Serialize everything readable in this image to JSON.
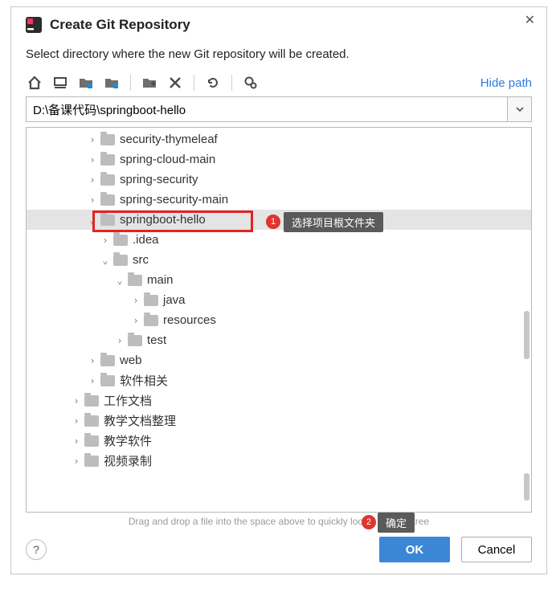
{
  "dialog": {
    "title": "Create Git Repository",
    "subtitle": "Select directory where the new Git repository will be created.",
    "hide_path": "Hide path",
    "hint": "Drag and drop a file into the space above to quickly locate it in the tree",
    "ok": "OK",
    "cancel": "Cancel"
  },
  "path": {
    "value": "D:\\备课代码\\springboot-hello"
  },
  "tree": {
    "items": [
      {
        "label": "security-thymeleaf",
        "indent": "ind1",
        "expand": ">",
        "selected": false
      },
      {
        "label": "spring-cloud-main",
        "indent": "ind1",
        "expand": ">",
        "selected": false
      },
      {
        "label": "spring-security",
        "indent": "ind1",
        "expand": ">",
        "selected": false
      },
      {
        "label": "spring-security-main",
        "indent": "ind1",
        "expand": ">",
        "selected": false
      },
      {
        "label": "springboot-hello",
        "indent": "ind1",
        "expand": "v",
        "selected": true
      },
      {
        "label": ".idea",
        "indent": "ind2",
        "expand": ">",
        "selected": false
      },
      {
        "label": "src",
        "indent": "ind2",
        "expand": "v",
        "selected": false
      },
      {
        "label": "main",
        "indent": "ind3",
        "expand": "v",
        "selected": false
      },
      {
        "label": "java",
        "indent": "ind4",
        "expand": ">",
        "selected": false
      },
      {
        "label": "resources",
        "indent": "ind4",
        "expand": ">",
        "selected": false
      },
      {
        "label": "test",
        "indent": "ind3",
        "expand": ">",
        "selected": false
      },
      {
        "label": "web",
        "indent": "ind1",
        "expand": ">",
        "selected": false
      },
      {
        "label": "软件相关",
        "indent": "ind1",
        "expand": ">",
        "selected": false
      },
      {
        "label": "工作文档",
        "indent": "indA",
        "expand": ">",
        "selected": false
      },
      {
        "label": "教学文档整理",
        "indent": "indA",
        "expand": ">",
        "selected": false
      },
      {
        "label": "教学软件",
        "indent": "indA",
        "expand": ">",
        "selected": false
      },
      {
        "label": "视频录制",
        "indent": "indA",
        "expand": ">",
        "selected": false
      }
    ]
  },
  "annotations": {
    "badge1": "1",
    "tip1": "选择项目根文件夹",
    "badge2": "2",
    "tip2": "确定"
  }
}
